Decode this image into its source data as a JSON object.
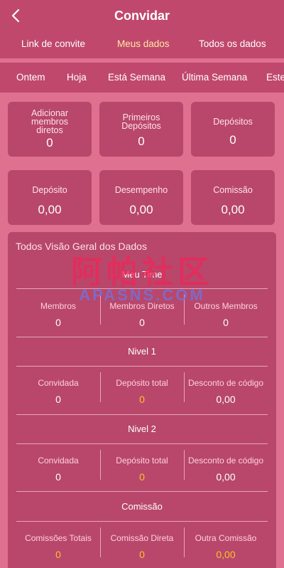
{
  "header": {
    "title": "Convidar",
    "back_icon": "chevron-left-icon"
  },
  "tabs": [
    {
      "label": "Link de convite",
      "active": false
    },
    {
      "label": "Meus dados",
      "active": true
    },
    {
      "label": "Todos os dados",
      "active": false
    }
  ],
  "periods": [
    "Ontem",
    "Hoja",
    "Está Semana",
    "Última Semana",
    "Este"
  ],
  "summary_cards": [
    {
      "label": "Adicionar membros diretos",
      "value": "0"
    },
    {
      "label": "Primeiros Depósitos",
      "value": "0"
    },
    {
      "label": "Depósitos",
      "value": "0"
    },
    {
      "label": "Depósito",
      "value": "0,00"
    },
    {
      "label": "Desempenho",
      "value": "0,00"
    },
    {
      "label": "Comissão",
      "value": "0,00"
    }
  ],
  "overview": {
    "title": "Todos Visão Geral dos Dados",
    "team": {
      "title": "Meu Time",
      "columns": [
        {
          "label": "Membros",
          "value": "0"
        },
        {
          "label": "Membros Diretos",
          "value": "0"
        },
        {
          "label": "Outros Membros",
          "value": "0"
        }
      ]
    },
    "level1": {
      "title": "Nivel 1",
      "columns": [
        {
          "label": "Convidada",
          "value": "0"
        },
        {
          "label": "Depósito total",
          "value": "0"
        },
        {
          "label": "Desconto de código",
          "value": "0,00"
        }
      ]
    },
    "level2": {
      "title": "Nivel 2",
      "columns": [
        {
          "label": "Convidada",
          "value": "0"
        },
        {
          "label": "Depósito total",
          "value": "0"
        },
        {
          "label": "Desconto de código",
          "value": "0,00"
        }
      ]
    },
    "commission": {
      "title": "Comissão",
      "columns": [
        {
          "label": "Comissões Totais",
          "value": "0"
        },
        {
          "label": "Comissão Direta",
          "value": "0"
        },
        {
          "label": "Outra Comissão",
          "value": "0,00"
        }
      ]
    }
  },
  "watermark": {
    "cn": "阿帕社区",
    "en": "APASNS.COM"
  },
  "colors": {
    "background": "#e07090",
    "bar": "#c0486c",
    "card": "#b8476b",
    "active_tab": "#ffe9a6",
    "highlight": "#ffc02a"
  }
}
